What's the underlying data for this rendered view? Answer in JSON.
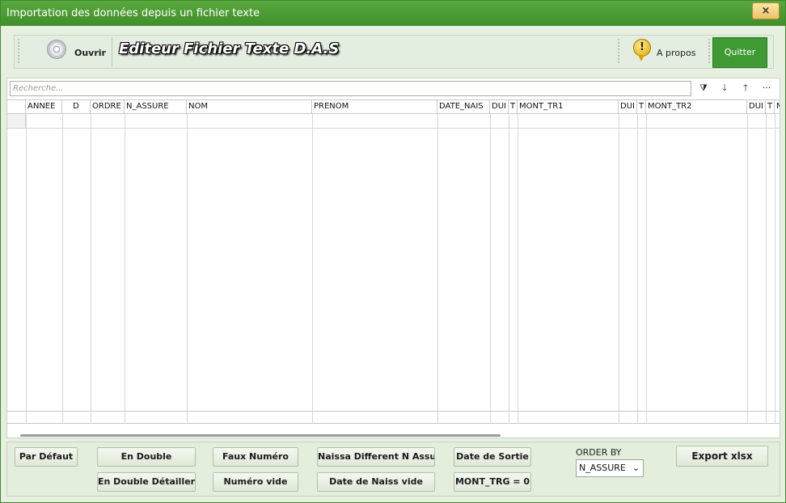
{
  "window": {
    "title": "Importation des données depuis un fichier texte",
    "close_label": "×"
  },
  "toolbar": {
    "open_label": "Ouvrir",
    "app_title": "Editeur Fichier Texte D.A.S",
    "about_label": "A propos",
    "about_icon_glyph": "!",
    "quit_label": "Quitter"
  },
  "search": {
    "placeholder": "Recherche..."
  },
  "grid_tools": {
    "filter": "⧩",
    "sort_down": "🡓",
    "sort_up": "🡑",
    "more": "···"
  },
  "grid": {
    "columns": [
      "ANNEE",
      "D",
      "ORDRE",
      "N_ASSURE",
      "NOM",
      "PRENOM",
      "DATE_NAIS",
      "DUI",
      "T",
      "MONT_TR1",
      "DUI",
      "T",
      "MONT_TR2",
      "DUI",
      "T",
      "M"
    ],
    "rows": []
  },
  "buttons": {
    "par_defaut": "Par Défaut",
    "en_double": "En Double",
    "en_double_detailler": "En Double Détailler",
    "faux_numero": "Faux Numéro",
    "numero_vide": "Numéro vide",
    "naissa_different": "Naissa Different N Assure",
    "date_naiss_vide": "Date de Naiss vide",
    "date_sortie": "Date de Sortie",
    "mont_trg": "MONT_TRG = 0",
    "export": "Export xlsx"
  },
  "order_by": {
    "label": "ORDER BY",
    "selected": "N_ASSURE",
    "chevron": "⌄"
  },
  "colors": {
    "titlebar": "#4a9b35",
    "quit_button": "#3f9a33",
    "panel": "#e6efe0"
  }
}
